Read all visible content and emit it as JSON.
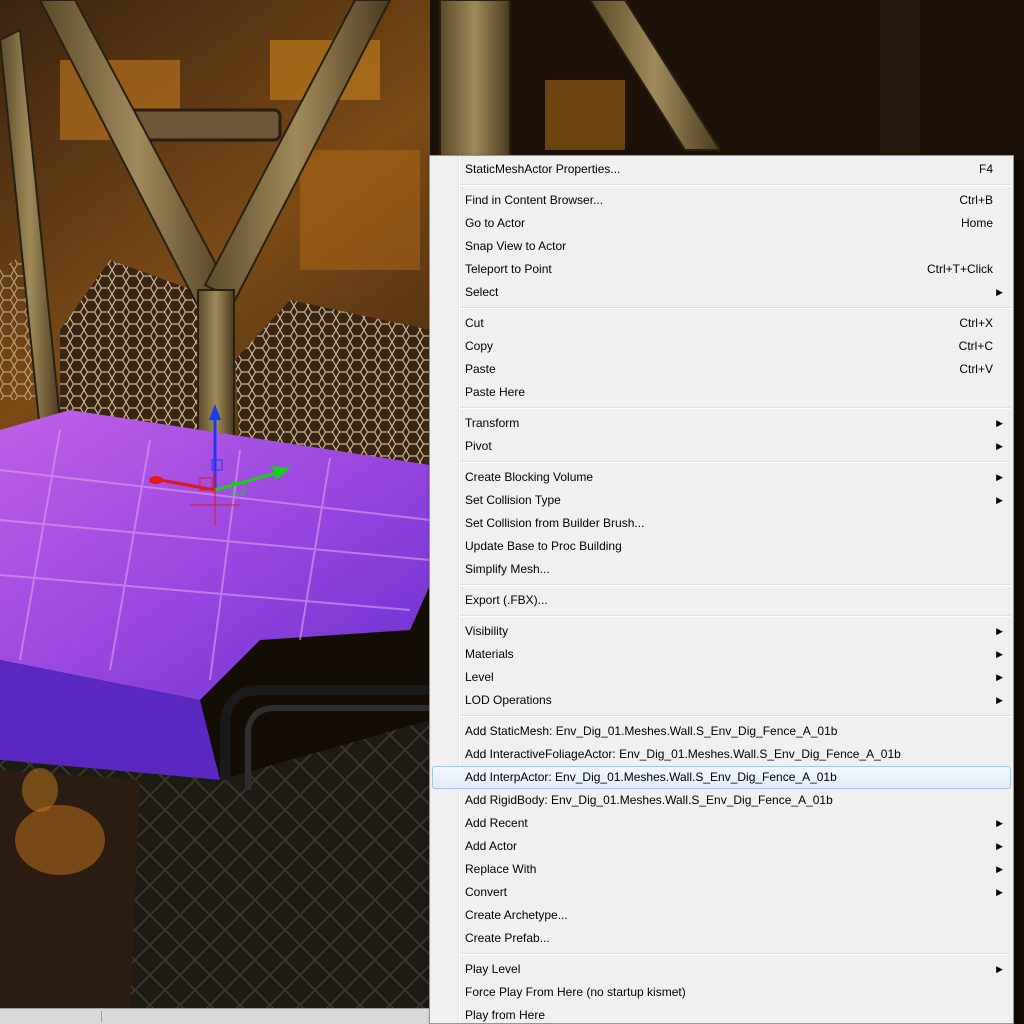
{
  "viewport": {
    "scene": "level-viewport",
    "gizmo_colors": {
      "x": "#e01818",
      "y": "#19d019",
      "z": "#1a3cf0"
    }
  },
  "context_menu": {
    "groups": [
      [
        {
          "label": "StaticMeshActor Properties...",
          "shortcut": "F4"
        }
      ],
      [
        {
          "label": "Find in Content Browser...",
          "shortcut": "Ctrl+B"
        },
        {
          "label": "Go to Actor",
          "shortcut": "Home"
        },
        {
          "label": "Snap View to Actor"
        },
        {
          "label": "Teleport to Point",
          "shortcut": "Ctrl+T+Click"
        },
        {
          "label": "Select",
          "submenu": true
        }
      ],
      [
        {
          "label": "Cut",
          "shortcut": "Ctrl+X"
        },
        {
          "label": "Copy",
          "shortcut": "Ctrl+C"
        },
        {
          "label": "Paste",
          "shortcut": "Ctrl+V"
        },
        {
          "label": "Paste Here"
        }
      ],
      [
        {
          "label": "Transform",
          "submenu": true
        },
        {
          "label": "Pivot",
          "submenu": true
        }
      ],
      [
        {
          "label": "Create Blocking Volume",
          "submenu": true
        },
        {
          "label": "Set Collision Type",
          "submenu": true
        },
        {
          "label": "Set Collision from Builder Brush..."
        },
        {
          "label": "Update Base to Proc Building"
        },
        {
          "label": "Simplify Mesh..."
        }
      ],
      [
        {
          "label": "Export (.FBX)..."
        }
      ],
      [
        {
          "label": "Visibility",
          "submenu": true
        },
        {
          "label": "Materials",
          "submenu": true
        },
        {
          "label": "Level",
          "submenu": true
        },
        {
          "label": "LOD Operations",
          "submenu": true
        }
      ],
      [
        {
          "label": "Add StaticMesh: Env_Dig_01.Meshes.Wall.S_Env_Dig_Fence_A_01b"
        },
        {
          "label": "Add InteractiveFoliageActor: Env_Dig_01.Meshes.Wall.S_Env_Dig_Fence_A_01b"
        },
        {
          "label": "Add InterpActor: Env_Dig_01.Meshes.Wall.S_Env_Dig_Fence_A_01b",
          "highlighted": true
        },
        {
          "label": "Add RigidBody: Env_Dig_01.Meshes.Wall.S_Env_Dig_Fence_A_01b"
        },
        {
          "label": "Add Recent",
          "submenu": true
        },
        {
          "label": "Add Actor",
          "submenu": true
        },
        {
          "label": "Replace With",
          "submenu": true
        },
        {
          "label": "Convert",
          "submenu": true
        },
        {
          "label": "Create Archetype..."
        },
        {
          "label": "Create Prefab..."
        }
      ],
      [
        {
          "label": "Play Level",
          "submenu": true
        },
        {
          "label": "Force Play From Here (no startup kismet)"
        },
        {
          "label": "Play from Here"
        }
      ]
    ]
  }
}
